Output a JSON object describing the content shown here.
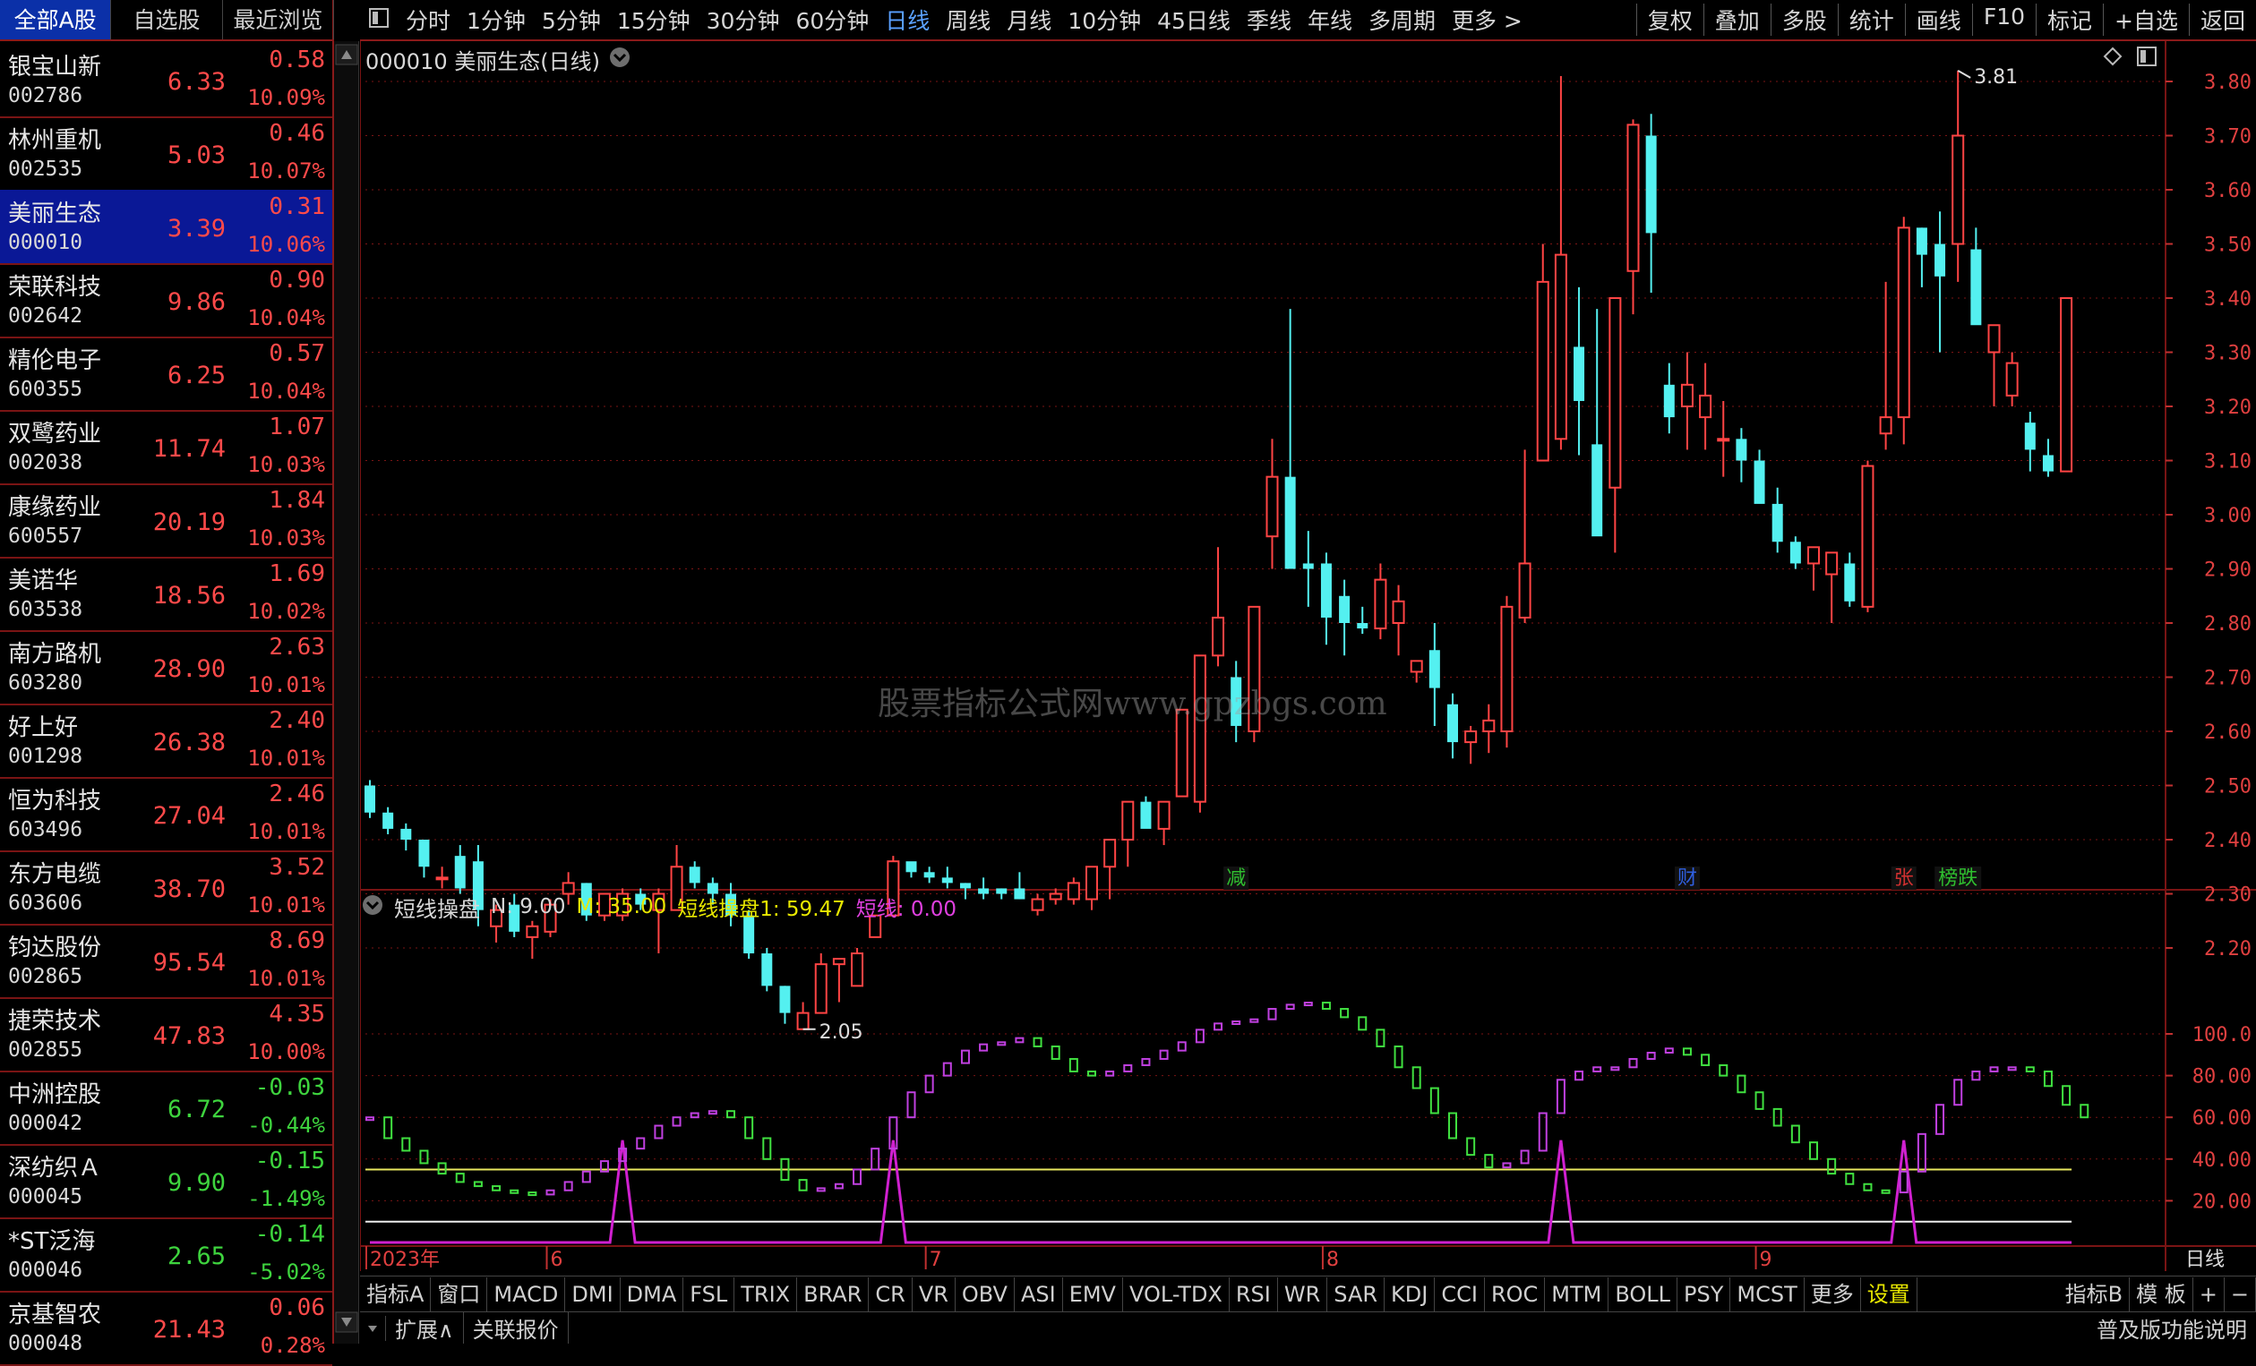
{
  "left_tabs": [
    "全部A股",
    "自选股",
    "最近浏览"
  ],
  "stocks": [
    {
      "name": "银宝山新",
      "code": "002786",
      "price": "6.33",
      "change": "0.58",
      "pct": "10.09%"
    },
    {
      "name": "林州重机",
      "code": "002535",
      "price": "5.03",
      "change": "0.46",
      "pct": "10.07%"
    },
    {
      "name": "美丽生态",
      "code": "000010",
      "price": "3.39",
      "change": "0.31",
      "pct": "10.06%"
    },
    {
      "name": "荣联科技",
      "code": "002642",
      "price": "9.86",
      "change": "0.90",
      "pct": "10.04%"
    },
    {
      "name": "精伦电子",
      "code": "600355",
      "price": "6.25",
      "change": "0.57",
      "pct": "10.04%"
    },
    {
      "name": "双鹭药业",
      "code": "002038",
      "price": "11.74",
      "change": "1.07",
      "pct": "10.03%"
    },
    {
      "name": "康缘药业",
      "code": "600557",
      "price": "20.19",
      "change": "1.84",
      "pct": "10.03%"
    },
    {
      "name": "美诺华",
      "code": "603538",
      "price": "18.56",
      "change": "1.69",
      "pct": "10.02%"
    },
    {
      "name": "南方路机",
      "code": "603280",
      "price": "28.90",
      "change": "2.63",
      "pct": "10.01%"
    },
    {
      "name": "好上好",
      "code": "001298",
      "price": "26.38",
      "change": "2.40",
      "pct": "10.01%"
    },
    {
      "name": "恒为科技",
      "code": "603496",
      "price": "27.04",
      "change": "2.46",
      "pct": "10.01%"
    },
    {
      "name": "东方电缆",
      "code": "603606",
      "price": "38.70",
      "change": "3.52",
      "pct": "10.01%"
    },
    {
      "name": "钧达股份",
      "code": "002865",
      "price": "95.54",
      "change": "8.69",
      "pct": "10.01%"
    },
    {
      "name": "捷荣技术",
      "code": "002855",
      "price": "47.83",
      "change": "4.35",
      "pct": "10.00%"
    },
    {
      "name": "中洲控股",
      "code": "000042",
      "price": "6.72",
      "change": "-0.03",
      "pct": "-0.44%"
    },
    {
      "name": "深纺织Ａ",
      "code": "000045",
      "price": "9.90",
      "change": "-0.15",
      "pct": "-1.49%"
    },
    {
      "name": "*ST泛海",
      "code": "000046",
      "price": "2.65",
      "change": "-0.14",
      "pct": "-5.02%"
    },
    {
      "name": "京基智农",
      "code": "000048",
      "price": "21.43",
      "change": "0.06",
      "pct": "0.28%"
    }
  ],
  "periods": [
    "分时",
    "1分钟",
    "5分钟",
    "15分钟",
    "30分钟",
    "60分钟",
    "日线",
    "周线",
    "月线",
    "10分钟",
    "45日线",
    "季线",
    "年线",
    "多周期",
    "更多 >"
  ],
  "active_period": "日线",
  "toolbar_right": [
    "复权",
    "叠加",
    "多股",
    "统计",
    "画线",
    "F10",
    "标记",
    "+自选",
    "返回"
  ],
  "chart_title": "000010 美丽生态(日线)",
  "watermark": "股票指标公式网www.gpzbgs.com",
  "price_axis": {
    "min": 2.2,
    "max": 3.8,
    "labels": [
      "3.80",
      "3.70",
      "3.60",
      "3.50",
      "3.40",
      "3.30",
      "3.20",
      "3.10",
      "3.00",
      "2.90",
      "2.80",
      "2.70",
      "2.60",
      "2.50",
      "2.40",
      "2.30",
      "2.20"
    ]
  },
  "high_label": "3.81",
  "low_label": "2.05",
  "markers": [
    {
      "text": "减",
      "color": "#2fbf2f",
      "i": 48
    },
    {
      "text": "财",
      "color": "#2f5fdf",
      "i": 73
    },
    {
      "text": "张",
      "color": "#d03030",
      "i": 85
    },
    {
      "text": "榜跌",
      "color": "#2fbf2f",
      "i": 88
    }
  ],
  "indicator_header": {
    "name": "短线操盘",
    "n": "N: 9.00",
    "m": "M: 35.00",
    "v1": "短线操盘1: 59.47",
    "v2": "短线: 0.00"
  },
  "indicator_axis": {
    "labels": [
      "100.0",
      "80.00",
      "60.00",
      "40.00",
      "20.00"
    ]
  },
  "date_labels": [
    {
      "text": "2023年",
      "i": 0
    },
    {
      "text": "6",
      "i": 10
    },
    {
      "text": "7",
      "i": 31
    },
    {
      "text": "8",
      "i": 53
    },
    {
      "text": "9",
      "i": 77
    }
  ],
  "date_axis_right": "日线",
  "indicator_tabs": [
    "指标A",
    "窗口",
    "MACD",
    "DMI",
    "DMA",
    "FSL",
    "TRIX",
    "BRAR",
    "CR",
    "VR",
    "OBV",
    "ASI",
    "EMV",
    "VOL-TDX",
    "RSI",
    "WR",
    "SAR",
    "KDJ",
    "CCI",
    "ROC",
    "MTM",
    "BOLL",
    "PSY",
    "MCST",
    "更多",
    "设置"
  ],
  "indicator_tabs_right": [
    "指标B",
    "模 板",
    "+",
    "−"
  ],
  "bottom_tabs": [
    "扩展∧",
    "关联报价"
  ],
  "bottom_right": "普及版功能说明",
  "colors": {
    "up": "#ff4444",
    "down": "#54f0f0",
    "ind_up": "#c040e0",
    "ind_down": "#40e040",
    "spike": "#d020d0",
    "grid": "#7a1414"
  },
  "chart_data": {
    "type": "candlestick",
    "ohlc": [
      [
        2.5,
        2.51,
        2.44,
        2.45
      ],
      [
        2.45,
        2.46,
        2.41,
        2.42
      ],
      [
        2.42,
        2.43,
        2.38,
        2.4
      ],
      [
        2.4,
        2.4,
        2.33,
        2.35
      ],
      [
        2.33,
        2.35,
        2.31,
        2.33
      ],
      [
        2.37,
        2.39,
        2.3,
        2.31
      ],
      [
        2.36,
        2.39,
        2.24,
        2.27
      ],
      [
        2.24,
        2.28,
        2.21,
        2.27
      ],
      [
        2.28,
        2.3,
        2.22,
        2.23
      ],
      [
        2.22,
        2.25,
        2.18,
        2.24
      ],
      [
        2.23,
        2.29,
        2.22,
        2.28
      ],
      [
        2.3,
        2.34,
        2.28,
        2.32
      ],
      [
        2.32,
        2.32,
        2.25,
        2.26
      ],
      [
        2.26,
        2.3,
        2.25,
        2.3
      ],
      [
        2.26,
        2.31,
        2.25,
        2.3
      ],
      [
        2.3,
        2.31,
        2.27,
        2.28
      ],
      [
        2.27,
        2.31,
        2.19,
        2.3
      ],
      [
        2.27,
        2.39,
        2.27,
        2.35
      ],
      [
        2.35,
        2.36,
        2.31,
        2.32
      ],
      [
        2.32,
        2.33,
        2.28,
        2.3
      ],
      [
        2.3,
        2.32,
        2.24,
        2.26
      ],
      [
        2.26,
        2.27,
        2.18,
        2.19
      ],
      [
        2.19,
        2.2,
        2.12,
        2.13
      ],
      [
        2.13,
        2.13,
        2.06,
        2.08
      ],
      [
        2.05,
        2.1,
        2.05,
        2.08
      ],
      [
        2.08,
        2.19,
        2.08,
        2.17
      ],
      [
        2.17,
        2.17,
        2.1,
        2.18
      ],
      [
        2.13,
        2.2,
        2.13,
        2.19
      ],
      [
        2.22,
        2.26,
        2.22,
        2.26
      ],
      [
        2.26,
        2.37,
        2.26,
        2.36
      ],
      [
        2.36,
        2.35,
        2.33,
        2.34
      ],
      [
        2.34,
        2.35,
        2.32,
        2.33
      ],
      [
        2.33,
        2.35,
        2.31,
        2.32
      ],
      [
        2.32,
        2.32,
        2.29,
        2.31
      ],
      [
        2.31,
        2.33,
        2.29,
        2.3
      ],
      [
        2.31,
        2.31,
        2.29,
        2.3
      ],
      [
        2.31,
        2.34,
        2.29,
        2.29
      ],
      [
        2.27,
        2.3,
        2.26,
        2.29
      ],
      [
        2.29,
        2.31,
        2.28,
        2.3
      ],
      [
        2.29,
        2.33,
        2.28,
        2.32
      ],
      [
        2.29,
        2.35,
        2.27,
        2.35
      ],
      [
        2.35,
        2.39,
        2.29,
        2.4
      ],
      [
        2.4,
        2.44,
        2.35,
        2.47
      ],
      [
        2.47,
        2.48,
        2.43,
        2.42
      ],
      [
        2.42,
        2.45,
        2.39,
        2.47
      ],
      [
        2.48,
        2.64,
        2.48,
        2.64
      ],
      [
        2.47,
        2.65,
        2.45,
        2.74
      ],
      [
        2.74,
        2.94,
        2.72,
        2.81
      ],
      [
        2.7,
        2.73,
        2.58,
        2.61
      ],
      [
        2.6,
        2.83,
        2.58,
        2.83
      ],
      [
        2.96,
        3.14,
        2.9,
        3.07
      ],
      [
        3.07,
        3.38,
        2.97,
        2.9
      ],
      [
        2.91,
        2.97,
        2.83,
        2.9
      ],
      [
        2.91,
        2.93,
        2.76,
        2.81
      ],
      [
        2.85,
        2.88,
        2.74,
        2.8
      ],
      [
        2.8,
        2.83,
        2.78,
        2.79
      ],
      [
        2.79,
        2.91,
        2.77,
        2.88
      ],
      [
        2.8,
        2.87,
        2.74,
        2.84
      ],
      [
        2.71,
        2.73,
        2.69,
        2.73
      ],
      [
        2.75,
        2.8,
        2.61,
        2.68
      ],
      [
        2.65,
        2.67,
        2.55,
        2.58
      ],
      [
        2.58,
        2.61,
        2.54,
        2.6
      ],
      [
        2.6,
        2.65,
        2.56,
        2.62
      ],
      [
        2.6,
        2.85,
        2.57,
        2.83
      ],
      [
        2.81,
        3.12,
        2.8,
        2.91
      ],
      [
        3.1,
        3.5,
        3.1,
        3.43
      ],
      [
        3.14,
        3.81,
        3.12,
        3.48
      ],
      [
        3.31,
        3.42,
        3.11,
        3.21
      ],
      [
        3.13,
        3.38,
        3.02,
        2.96
      ],
      [
        3.05,
        3.4,
        2.93,
        3.4
      ],
      [
        3.45,
        3.73,
        3.37,
        3.72
      ],
      [
        3.7,
        3.74,
        3.41,
        3.52
      ],
      [
        3.24,
        3.28,
        3.15,
        3.18
      ],
      [
        3.2,
        3.3,
        3.12,
        3.24
      ],
      [
        3.18,
        3.28,
        3.12,
        3.22
      ],
      [
        3.14,
        3.21,
        3.07,
        3.14
      ],
      [
        3.14,
        3.16,
        3.06,
        3.1
      ],
      [
        3.1,
        3.12,
        3.05,
        3.02
      ],
      [
        3.02,
        3.05,
        2.93,
        2.95
      ],
      [
        2.95,
        2.96,
        2.9,
        2.91
      ],
      [
        2.91,
        2.94,
        2.86,
        2.94
      ],
      [
        2.89,
        2.93,
        2.8,
        2.93
      ],
      [
        2.91,
        2.93,
        2.83,
        2.84
      ],
      [
        2.83,
        3.1,
        2.82,
        3.09
      ],
      [
        3.15,
        3.43,
        3.12,
        3.18
      ],
      [
        3.18,
        3.55,
        3.13,
        3.53
      ],
      [
        3.53,
        3.53,
        3.42,
        3.48
      ],
      [
        3.5,
        3.56,
        3.3,
        3.44
      ],
      [
        3.5,
        3.82,
        3.43,
        3.7
      ],
      [
        3.49,
        3.53,
        3.43,
        3.35
      ],
      [
        3.3,
        3.35,
        3.2,
        3.35
      ],
      [
        3.22,
        3.3,
        3.2,
        3.28
      ],
      [
        3.17,
        3.19,
        3.08,
        3.12
      ],
      [
        3.11,
        3.14,
        3.07,
        3.08
      ],
      [
        3.08,
        3.14,
        3.08,
        3.4
      ]
    ],
    "ind_values": [
      60,
      50,
      44,
      38,
      33,
      29,
      27,
      25,
      24,
      23,
      25,
      29,
      34,
      39,
      45,
      50,
      56,
      60,
      62,
      63,
      60,
      50,
      40,
      30,
      25,
      26,
      28,
      35,
      45,
      60,
      72,
      80,
      86,
      92,
      95,
      96,
      98,
      94,
      88,
      82,
      80,
      82,
      85,
      88,
      92,
      96,
      102,
      105,
      106,
      107,
      112,
      114,
      115,
      112,
      108,
      102,
      94,
      84,
      74,
      62,
      50,
      42,
      36,
      38,
      44,
      62,
      78,
      82,
      84,
      84,
      88,
      91,
      93,
      90,
      85,
      80,
      72,
      64,
      56,
      48,
      40,
      33,
      28,
      25,
      24,
      34,
      52,
      66,
      78,
      82,
      84,
      84,
      82,
      75,
      66,
      60
    ],
    "yellow_line": 35,
    "white_line": 10,
    "spikes": [
      14,
      29,
      66,
      85
    ],
    "spike_height": 49,
    "ind_range": [
      0,
      115
    ]
  }
}
